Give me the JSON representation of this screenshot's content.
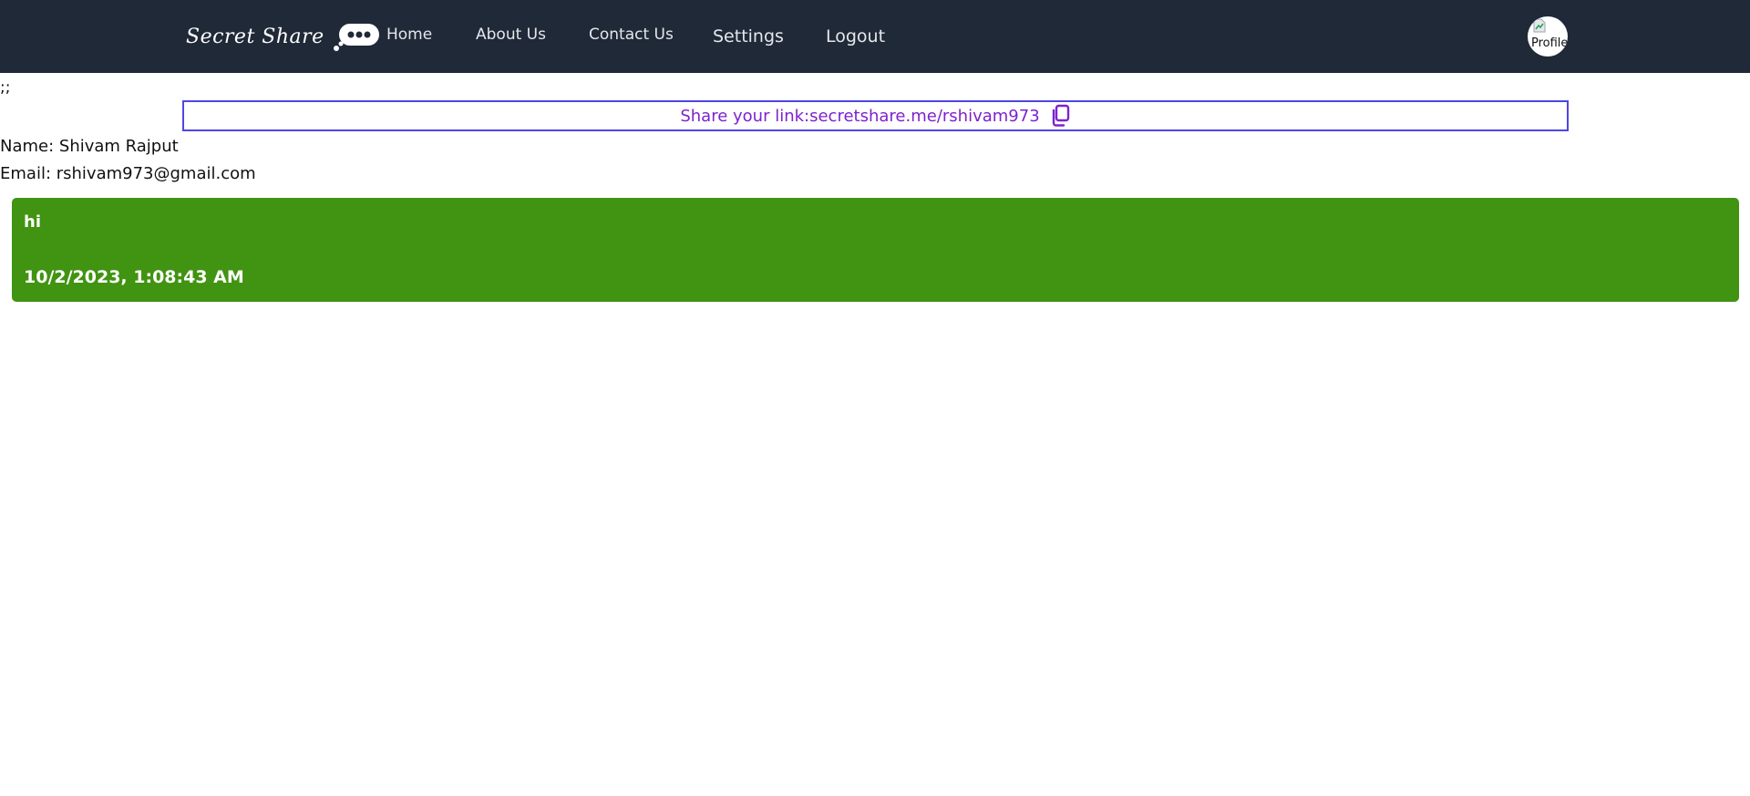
{
  "nav": {
    "brand": "Secret Share",
    "links": {
      "home": "Home",
      "about": "About Us",
      "contact": "Contact Us",
      "settings": "Settings",
      "logout": "Logout"
    },
    "profile_alt": "Profile"
  },
  "page": {
    "stray_text": ";;",
    "share_label": "Share your link:",
    "share_link": "secretshare.me/rshivam973",
    "name_line": "Name: Shivam Rajput",
    "email_line": "Email: rshivam973@gmail.com"
  },
  "messages": [
    {
      "text": "hi",
      "time": "10/2/2023, 1:08:43 AM"
    }
  ],
  "colors": {
    "navbar_bg": "#1f2937",
    "share_text": "#7e22ce",
    "share_border": "#4f46e5",
    "message_bg": "#419312"
  },
  "icons": {
    "brand_bubble": "chat-bubble-icon",
    "copy": "copy-icon",
    "profile": "broken-image-icon"
  }
}
